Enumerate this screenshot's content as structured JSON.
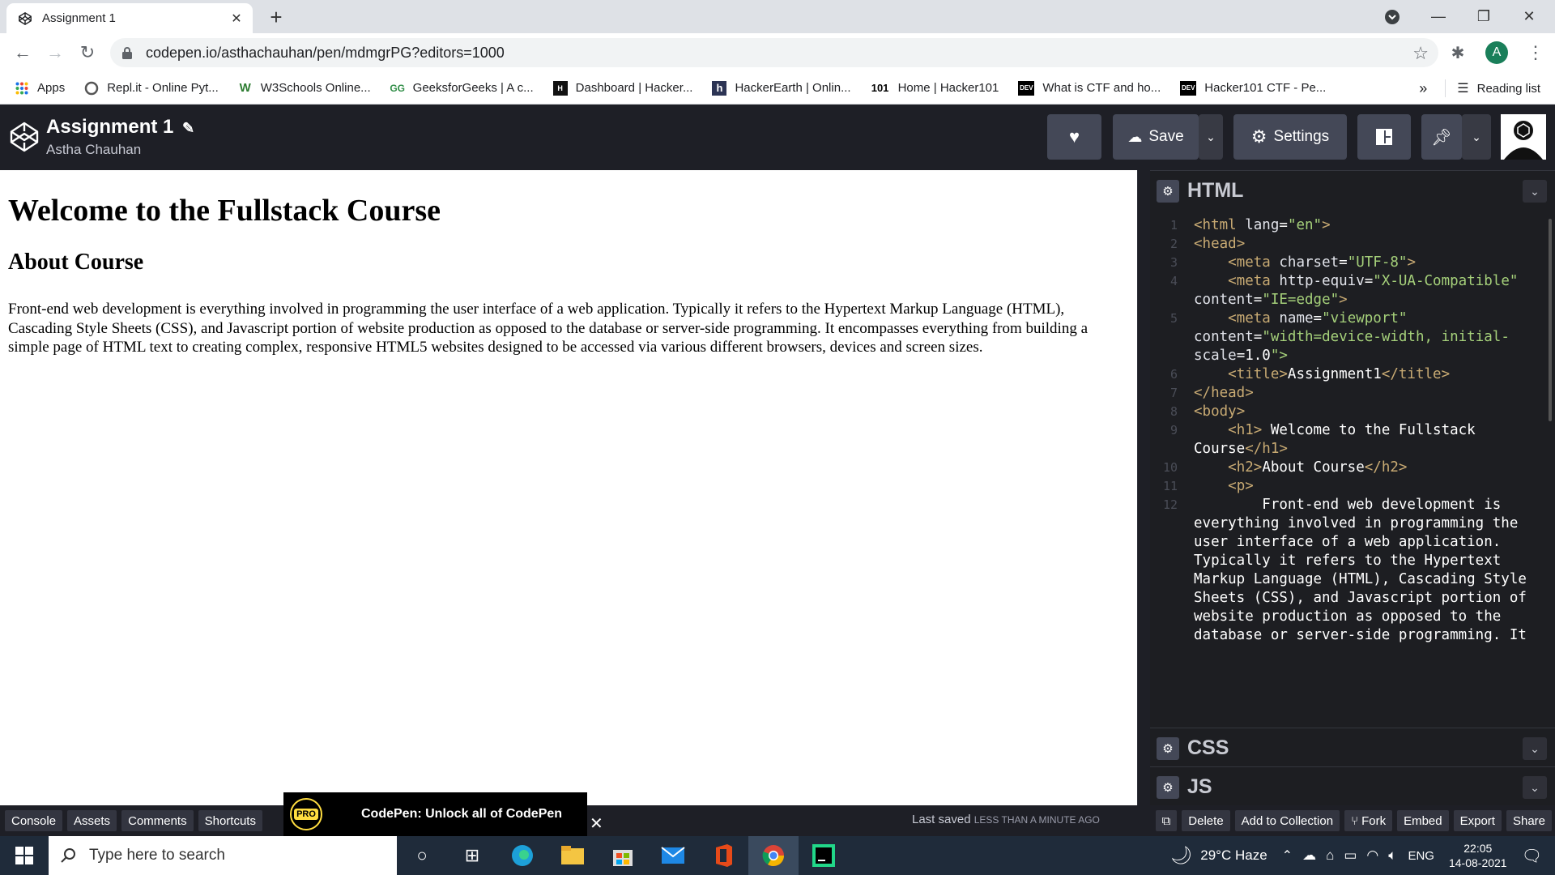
{
  "browser": {
    "tab_title": "Assignment 1",
    "url": "codepen.io/asthachauhan/pen/mdmgrPG?editors=1000",
    "bookmarks": [
      {
        "label": "Apps",
        "icon": "apps-grid-icon"
      },
      {
        "label": "Repl.it - Online Pyt...",
        "icon": "replit-icon"
      },
      {
        "label": "W3Schools Online...",
        "icon": "w3schools-icon"
      },
      {
        "label": "GeeksforGeeks | A c...",
        "icon": "geeksforgeeks-icon"
      },
      {
        "label": "Dashboard | Hacker...",
        "icon": "hackerrank-icon"
      },
      {
        "label": "HackerEarth | Onlin...",
        "icon": "hackerearth-icon"
      },
      {
        "label": "Home | Hacker101",
        "icon": "hacker101-icon"
      },
      {
        "label": "What is CTF and ho...",
        "icon": "dev-icon"
      },
      {
        "label": "Hacker101 CTF - Pe...",
        "icon": "dev-icon"
      }
    ],
    "more_bookmarks": "»",
    "reading_list": "Reading list",
    "profile_initial": "A"
  },
  "codepen": {
    "pen_title": "Assignment 1",
    "author": "Astha Chauhan",
    "save_label": "Save",
    "settings_label": "Settings"
  },
  "preview": {
    "h1": "Welcome to the Fullstack Course",
    "h2": "About Course",
    "paragraph": "Front-end web development is everything involved in programming the user interface of a web application. Typically it refers to the Hypertext Markup Language (HTML), Cascading Style Sheets (CSS), and Javascript portion of website production as opposed to the database or server-side programming. It encompasses everything from building a simple page of HTML text to creating complex, responsive HTML5 websites designed to be accessed via various different browsers, devices and screen sizes."
  },
  "editors": {
    "html_label": "HTML",
    "css_label": "CSS",
    "js_label": "JS",
    "code_lines": [
      {
        "num": "1",
        "text": "<html lang=\"en\">"
      },
      {
        "num": "2",
        "text": "<head>"
      },
      {
        "num": "3",
        "text": "    <meta charset=\"UTF-8\">"
      },
      {
        "num": "4",
        "text": "    <meta http-equiv=\"X-UA-Compatible\""
      },
      {
        "num": "",
        "text": "content=\"IE=edge\">"
      },
      {
        "num": "5",
        "text": "    <meta name=\"viewport\""
      },
      {
        "num": "",
        "text": "content=\"width=device-width, initial-"
      },
      {
        "num": "",
        "text": "scale=1.0\">"
      },
      {
        "num": "6",
        "text": "    <title>Assignment1</title>"
      },
      {
        "num": "7",
        "text": "</head>"
      },
      {
        "num": "8",
        "text": "<body>"
      },
      {
        "num": "9",
        "text": "    <h1> Welcome to the Fullstack"
      },
      {
        "num": "",
        "text": "Course</h1>"
      },
      {
        "num": "10",
        "text": "    <h2>About Course</h2>"
      },
      {
        "num": "11",
        "text": "    <p>"
      },
      {
        "num": "12",
        "text": "        Front-end web development is"
      },
      {
        "num": "",
        "text": "everything involved in programming the"
      },
      {
        "num": "",
        "text": "user interface of a web application."
      },
      {
        "num": "",
        "text": "Typically it refers to the Hypertext"
      },
      {
        "num": "",
        "text": "Markup Language (HTML), Cascading Style"
      },
      {
        "num": "",
        "text": "Sheets (CSS), and Javascript portion of"
      },
      {
        "num": "",
        "text": "website production as opposed to the"
      },
      {
        "num": "",
        "text": "database or server-side programming. It"
      }
    ]
  },
  "footer": {
    "console": "Console",
    "assets": "Assets",
    "comments": "Comments",
    "shortcuts": "Shortcuts",
    "pro_badge": "PRO",
    "promo_text": "CodePen: Unlock all of CodePen",
    "last_saved": "Last saved",
    "last_saved_time": "LESS THAN A MINUTE AGO",
    "delete": "Delete",
    "add_to_collection": "Add to Collection",
    "fork": "Fork",
    "embed": "Embed",
    "export": "Export",
    "share": "Share"
  },
  "taskbar": {
    "search_placeholder": "Type here to search",
    "weather": "29°C  Haze",
    "language": "ENG",
    "time": "22:05",
    "date": "14-08-2021"
  }
}
